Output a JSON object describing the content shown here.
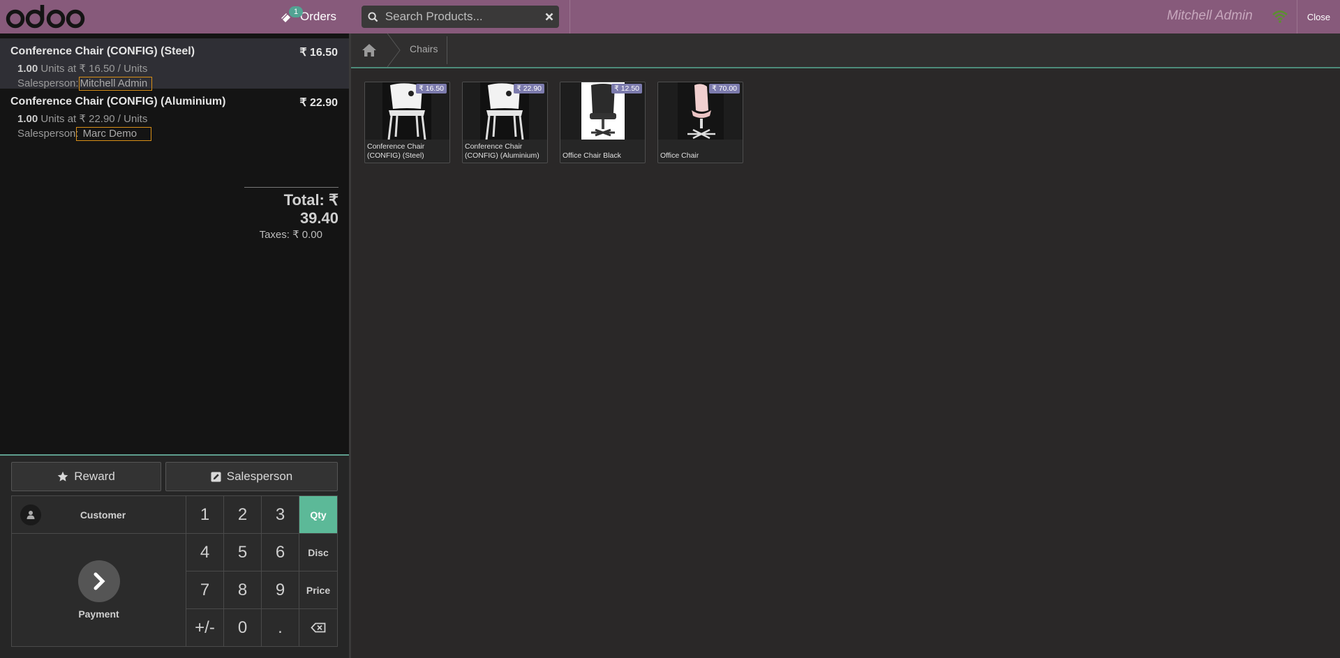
{
  "header": {
    "orders_label": "Orders",
    "orders_badge": "1",
    "search_placeholder": "Search Products...",
    "user_name": "Mitchell Admin",
    "close_label": "Close"
  },
  "order": {
    "lines": [
      {
        "name": "Conference Chair (CONFIG) (Steel)",
        "price": "₹ 16.50",
        "qty": "1.00",
        "unit_info": "Units at ₹ 16.50 / Units",
        "salesperson_label": "Salesperson:",
        "salesperson": "Mitchell Admin"
      },
      {
        "name": "Conference Chair (CONFIG) (Aluminium)",
        "price": "₹ 22.90",
        "qty": "1.00",
        "unit_info": "Units at ₹ 22.90 / Units",
        "salesperson_label": "Salesperson:",
        "salesperson": "Marc Demo"
      }
    ],
    "total": "Total: ₹ 39.40",
    "taxes": "Taxes: ₹ 0.00"
  },
  "controls": {
    "reward_label": "Reward",
    "salesperson_label": "Salesperson",
    "customer_label": "Customer",
    "payment_label": "Payment",
    "keys": [
      "1",
      "2",
      "3",
      "4",
      "5",
      "6",
      "7",
      "8",
      "9",
      "+/-",
      "0",
      "."
    ],
    "modes": [
      "Qty",
      "Disc",
      "Price"
    ],
    "active_mode": "Qty"
  },
  "breadcrumb": {
    "category": "Chairs"
  },
  "products": [
    {
      "name": "Conference Chair (CONFIG) (Steel)",
      "price": "₹ 16.50"
    },
    {
      "name": "Conference Chair (CONFIG) (Aluminium)",
      "price": "₹ 22.90"
    },
    {
      "name": "Office Chair Black",
      "price": "₹ 12.50"
    },
    {
      "name": "Office Chair",
      "price": "₹ 70.00"
    }
  ],
  "colors": {
    "header_bg": "#875a7b",
    "accent": "#5cb998",
    "price_badge": "#7c7bad",
    "highlight_box": "#d88f17"
  }
}
